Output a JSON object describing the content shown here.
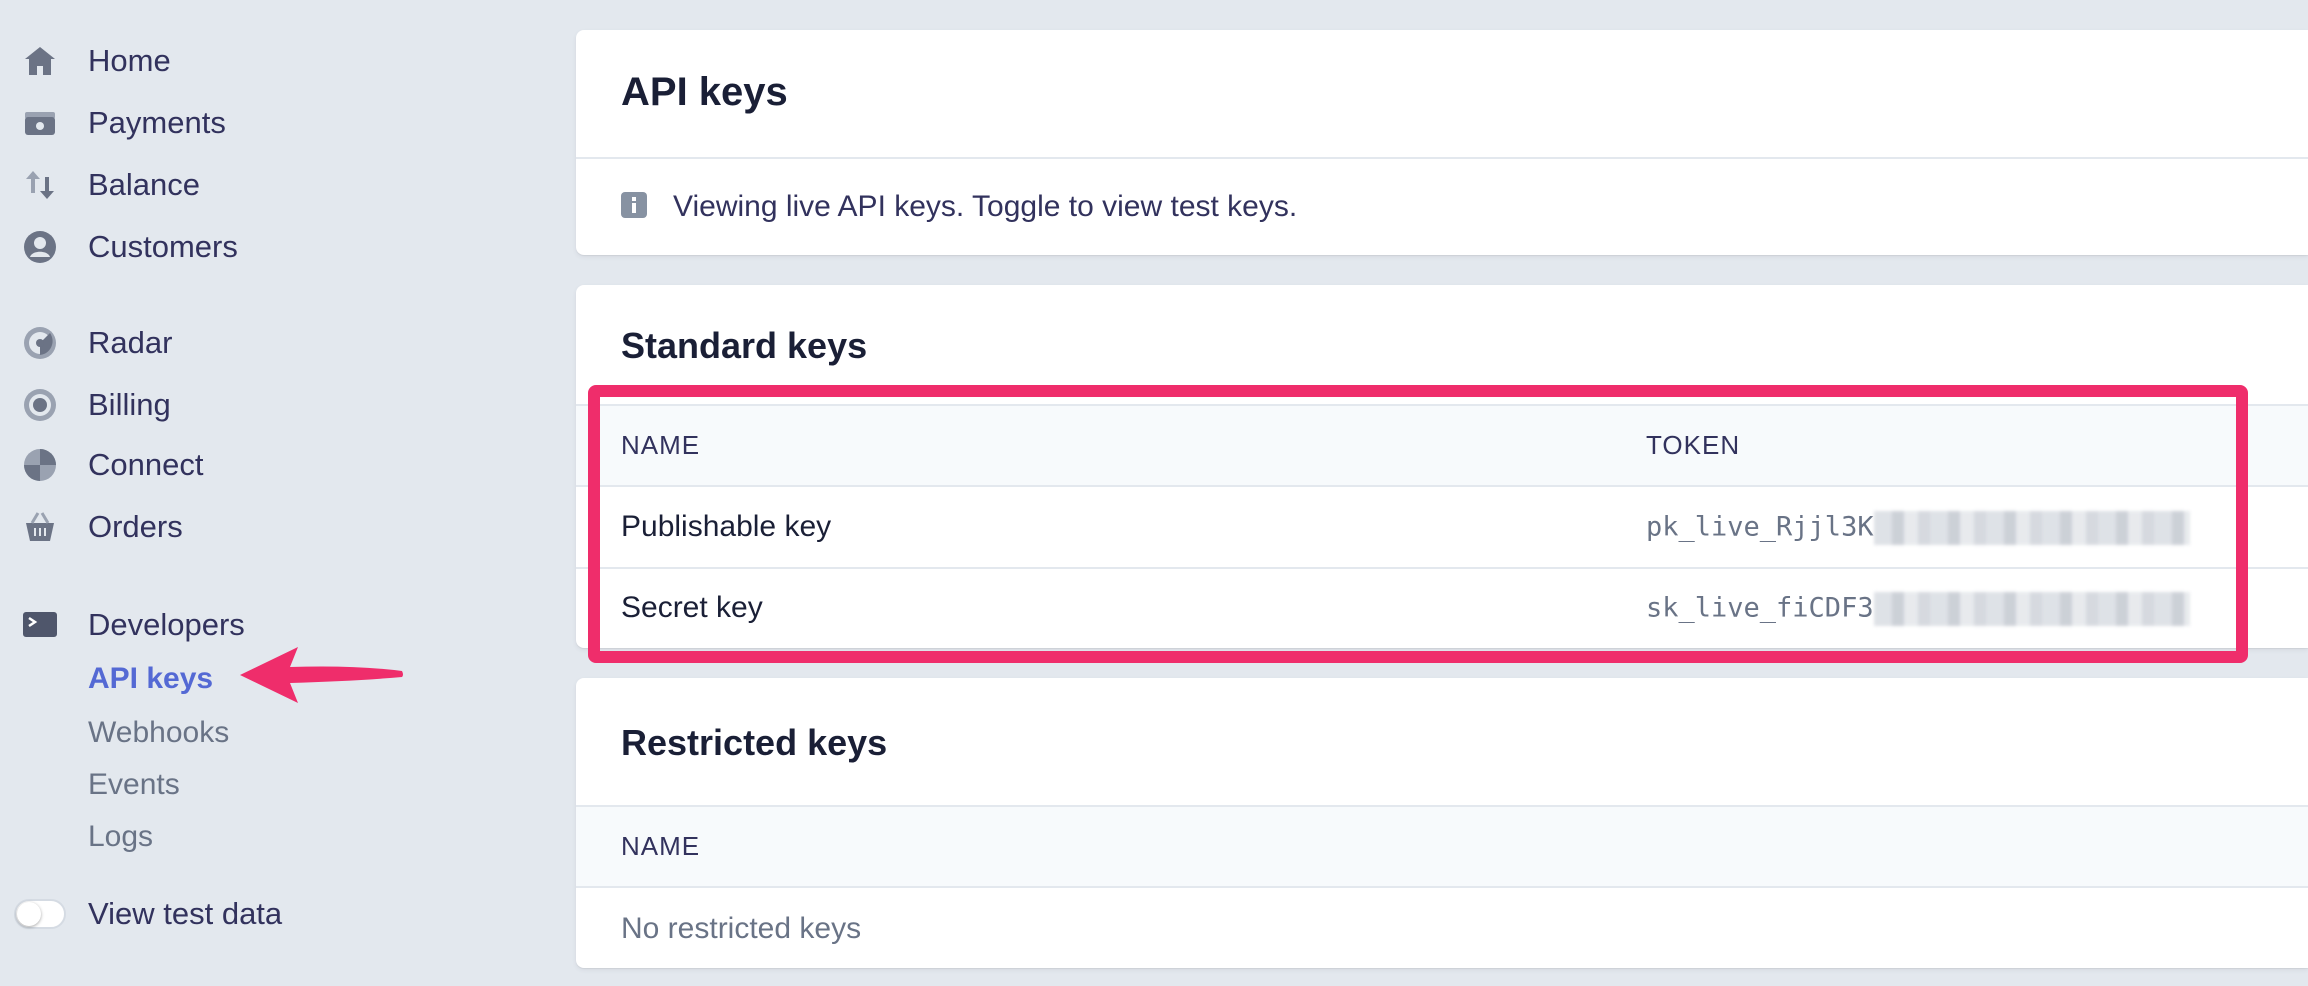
{
  "sidebar": {
    "nav": [
      {
        "label": "Home",
        "icon": "home-icon"
      },
      {
        "label": "Payments",
        "icon": "payments-icon"
      },
      {
        "label": "Balance",
        "icon": "balance-icon"
      },
      {
        "label": "Customers",
        "icon": "customers-icon"
      },
      {
        "label": "Radar",
        "icon": "radar-icon"
      },
      {
        "label": "Billing",
        "icon": "billing-icon"
      },
      {
        "label": "Connect",
        "icon": "connect-icon"
      },
      {
        "label": "Orders",
        "icon": "orders-icon"
      },
      {
        "label": "Developers",
        "icon": "terminal-icon"
      }
    ],
    "developer_links": [
      "API keys",
      "Webhooks",
      "Events",
      "Logs"
    ],
    "active_link": "API keys",
    "test_data_label": "View test data",
    "test_data_enabled": false
  },
  "page": {
    "title": "API keys",
    "info_text": "Viewing live API keys. Toggle to view test keys."
  },
  "standard_keys": {
    "title": "Standard keys",
    "columns": [
      "NAME",
      "TOKEN"
    ],
    "rows": [
      {
        "name": "Publishable key",
        "token": "pk_live_Rjjl3K"
      },
      {
        "name": "Secret key",
        "token": "sk_live_fiCDF3"
      }
    ]
  },
  "restricted_keys": {
    "title": "Restricted keys",
    "columns": [
      "NAME"
    ],
    "empty_text": "No restricted keys"
  },
  "colors": {
    "highlight": "#ef2d6b",
    "accent": "#5469d4",
    "background": "#e3e8ee"
  }
}
